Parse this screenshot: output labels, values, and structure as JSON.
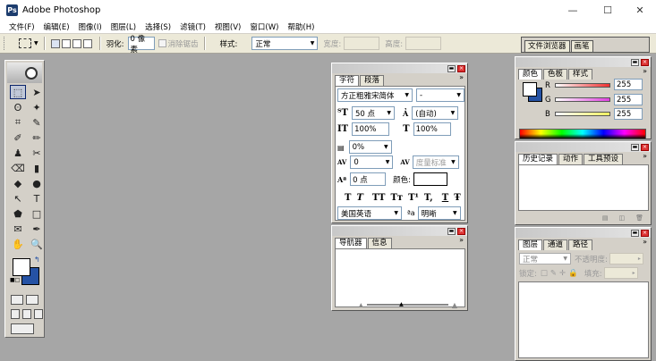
{
  "window": {
    "title": "Adobe Photoshop",
    "minimize": "—",
    "maximize": "☐",
    "close": "✕"
  },
  "menu": [
    "文件(F)",
    "编辑(E)",
    "图像(I)",
    "图层(L)",
    "选择(S)",
    "滤镜(T)",
    "视图(V)",
    "窗口(W)",
    "帮助(H)"
  ],
  "options": {
    "feather_label": "羽化:",
    "feather_value": "0 像素",
    "antialias_label": "消除锯齿",
    "style_label": "样式:",
    "style_value": "正常",
    "width_label": "宽度:",
    "height_label": "高度:",
    "well_tabs": [
      "文件浏览器",
      "画笔"
    ]
  },
  "character": {
    "tabs": [
      "字符",
      "段落"
    ],
    "font_family": "方正粗雅宋简体",
    "font_style": "-",
    "size": "50 点",
    "leading": "(自动)",
    "vscale": "100%",
    "hscale": "100%",
    "tracking_pct": "0%",
    "kerning": "0",
    "tracking": "度量标准",
    "baseline": "0 点",
    "color_label": "颜色:",
    "style_buttons": [
      "T",
      "T",
      "TT",
      "Tт",
      "T¹",
      "T,",
      "T",
      "Ŧ"
    ],
    "language": "美国英语",
    "antialias_prefix": "ªa",
    "antialias": "明晰"
  },
  "navigator": {
    "tabs": [
      "导航器",
      "信息"
    ]
  },
  "color": {
    "tabs": [
      "颜色",
      "色板",
      "样式"
    ],
    "channels": [
      {
        "name": "R",
        "value": "255"
      },
      {
        "name": "G",
        "value": "255"
      },
      {
        "name": "B",
        "value": "255"
      }
    ],
    "bar_colors": [
      "#f03030",
      "#e040e0",
      "#f0f060"
    ]
  },
  "history": {
    "tabs": [
      "历史记录",
      "动作",
      "工具预设"
    ]
  },
  "layers": {
    "tabs": [
      "图层",
      "通道",
      "路径"
    ],
    "blend_mode": "正常",
    "opacity_label": "不透明度:",
    "lock_label": "锁定:",
    "fill_label": "填充:"
  },
  "toolbox": {
    "tools": [
      "⬚",
      "➤",
      "ʘ",
      "✦",
      "⌗",
      "✎",
      "✐",
      "✏",
      "♟",
      "✂",
      "⌫",
      "▮",
      "◆",
      "●",
      "↖",
      "T",
      "⬟",
      "□",
      "✉",
      "✒",
      "✋",
      "🔍"
    ]
  }
}
